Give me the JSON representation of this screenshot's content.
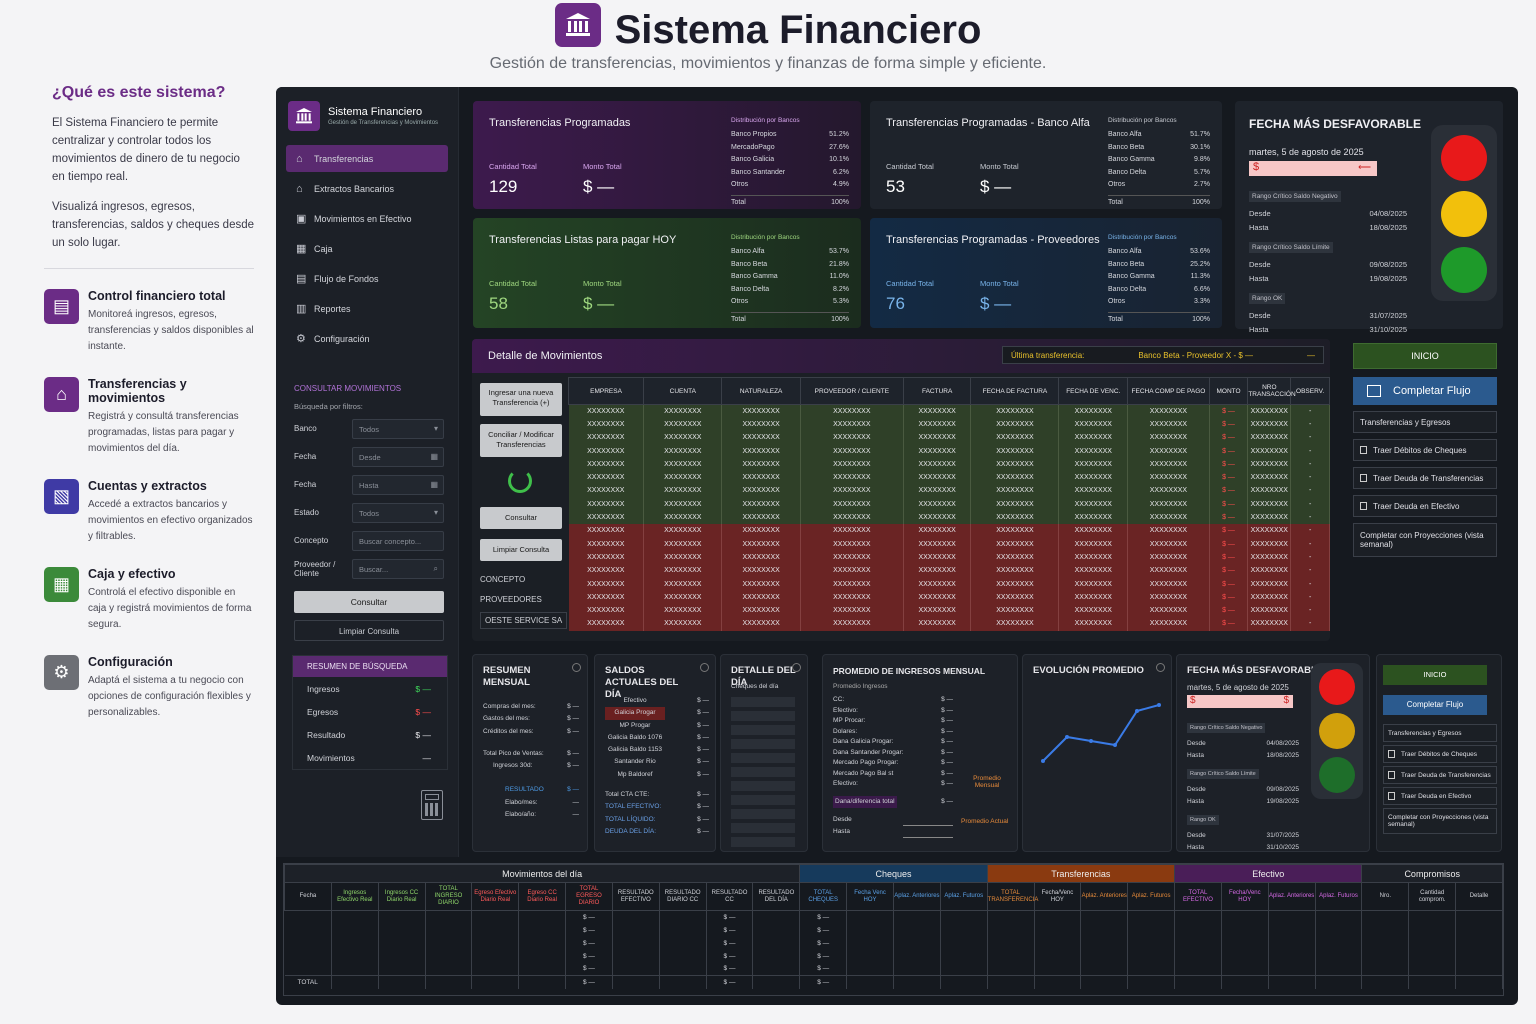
{
  "header": {
    "title": "Sistema Financiero",
    "subtitle": "Gestión de transferencias, movimientos y finanzas de forma simple y eficiente."
  },
  "intro": {
    "title": "¿Qué es este sistema?",
    "p1": "El Sistema Financiero te permite centralizar y controlar todos los movimientos de dinero de tu negocio en tiempo real.",
    "p2": "Visualizá ingresos, egresos, transferencias, saldos y cheques desde un solo lugar."
  },
  "features": [
    {
      "title": "Control financiero total",
      "text": "Monitoreá ingresos, egresos, transferencias y saldos disponibles al instante.",
      "color": "#6b2c86",
      "icon": "chart-icon"
    },
    {
      "title": "Transferencias y movimientos",
      "text": "Registrá y consultá transferencias programadas, listas para pagar y movimientos del día.",
      "color": "#6b2c86",
      "icon": "bank-icon"
    },
    {
      "title": "Cuentas y extractos",
      "text": "Accedé a extractos bancarios y movimientos en efectivo organizados y filtrables.",
      "color": "#3f3aa5",
      "icon": "document-icon"
    },
    {
      "title": "Caja y efectivo",
      "text": "Controlá el efectivo disponible en caja y registrá movimientos de forma segura.",
      "color": "#3b8a3a",
      "icon": "register-icon"
    },
    {
      "title": "Configuración",
      "text": "Adaptá el sistema a tu negocio con opciones de configuración flexibles y personalizables.",
      "color": "#6d6f75",
      "icon": "gear-icon"
    }
  ],
  "sidebar": {
    "title": "Sistema Financiero",
    "subtitle": "Gestión de Transferencias y Movimientos",
    "items": [
      {
        "label": "Transferencias",
        "icon": "bank-icon"
      },
      {
        "label": "Extractos Bancarios",
        "icon": "bank-icon"
      },
      {
        "label": "Movimientos en Efectivo",
        "icon": "cash-icon"
      },
      {
        "label": "Caja",
        "icon": "register-icon"
      },
      {
        "label": "Flujo de Fondos",
        "icon": "document-icon"
      },
      {
        "label": "Reportes",
        "icon": "report-icon"
      },
      {
        "label": "Configuración",
        "icon": "gear-icon"
      }
    ],
    "consult_title": "CONSULTAR MOVIMIENTOS",
    "filters_label": "Búsqueda por filtros:",
    "filters": [
      {
        "label": "Banco",
        "value": "Todos"
      },
      {
        "label": "Fecha",
        "value": "Desde"
      },
      {
        "label": "Fecha",
        "value": "Hasta"
      },
      {
        "label": "Estado",
        "value": "Todos"
      },
      {
        "label": "Concepto",
        "value": "Buscar concepto..."
      },
      {
        "label": "Proveedor / Cliente",
        "value": "Buscar..."
      }
    ],
    "consult_btn": "Consultar",
    "clear_btn": "Limpiar Consulta",
    "summary": {
      "title": "RESUMEN DE BÚSQUEDA",
      "rows": [
        {
          "label": "Ingresos",
          "value": "$ —"
        },
        {
          "label": "Egresos",
          "value": "$ —"
        },
        {
          "label": "Resultado",
          "value": "$ —"
        },
        {
          "label": "Movimientos",
          "value": "—"
        }
      ]
    }
  },
  "cards": {
    "c1": {
      "title": "Transferencias Programadas",
      "qty_label": "Cantidad Total",
      "qty": "129",
      "amt_label": "Monto Total",
      "amt": "$ —",
      "dist_title": "Distribución por Bancos",
      "dist": [
        [
          "Banco Propios",
          "51.2%"
        ],
        [
          "MercadoPago",
          "27.6%"
        ],
        [
          "Banco Galicia",
          "10.1%"
        ],
        [
          "Banco Santander",
          "6.2%"
        ],
        [
          "Otros",
          "4.9%"
        ]
      ],
      "total": [
        "Total",
        "100%"
      ]
    },
    "c2": {
      "title": "Transferencias Programadas - Banco Alfa",
      "qty_label": "Cantidad Total",
      "qty": "53",
      "amt_label": "Monto Total",
      "amt": "$ —",
      "dist_title": "Distribución por Bancos",
      "dist": [
        [
          "Banco Alfa",
          "51.7%"
        ],
        [
          "Banco Beta",
          "30.1%"
        ],
        [
          "Banco Gamma",
          "9.8%"
        ],
        [
          "Banco Delta",
          "5.7%"
        ],
        [
          "Otros",
          "2.7%"
        ]
      ],
      "total": [
        "Total",
        "100%"
      ]
    },
    "c3": {
      "title": "Transferencias Listas para pagar HOY",
      "qty_label": "Cantidad Total",
      "qty": "58",
      "amt_label": "Monto Total",
      "amt": "$ —",
      "dist_title": "Distribución por Bancos",
      "dist": [
        [
          "Banco Alfa",
          "53.7%"
        ],
        [
          "Banco Beta",
          "21.8%"
        ],
        [
          "Banco Gamma",
          "11.0%"
        ],
        [
          "Banco Delta",
          "8.2%"
        ],
        [
          "Otros",
          "5.3%"
        ]
      ],
      "total": [
        "Total",
        "100%"
      ]
    },
    "c4": {
      "title": "Transferencias Programadas - Proveedores",
      "qty_label": "Cantidad Total",
      "qty": "76",
      "amt_label": "Monto Total",
      "amt": "$ —",
      "dist_title": "Distribución por Bancos",
      "dist": [
        [
          "Banco Alfa",
          "53.6%"
        ],
        [
          "Banco Beta",
          "25.2%"
        ],
        [
          "Banco Gamma",
          "11.3%"
        ],
        [
          "Banco Delta",
          "6.6%"
        ],
        [
          "Otros",
          "3.3%"
        ]
      ],
      "total": [
        "Total",
        "100%"
      ]
    }
  },
  "fecha": {
    "title": "FECHA MÁS DESFAVORABLE",
    "date": "martes, 5 de agosto de 2025",
    "bar": "$",
    "ranges": [
      {
        "title": "Rango Crítico Saldo Negativo",
        "desde": "04/08/2025",
        "hasta": "18/08/2025"
      },
      {
        "title": "Rango Crítico Saldo Límite",
        "desde": "09/08/2025",
        "hasta": "19/08/2025"
      },
      {
        "title": "Rango OK",
        "desde": "31/07/2025",
        "hasta": "31/10/2025"
      }
    ],
    "desde_label": "Desde",
    "hasta_label": "Hasta"
  },
  "detalle": {
    "title": "Detalle de Movimientos",
    "ultima_label": "Última transferencia:",
    "ultima_value": "Banco Beta - Proveedor X - $ —",
    "ultima_dash": "—",
    "btn_new": "Ingresar una nueva Transferencia (+)",
    "btn_mod": "Conciliar / Modificar Transferencias",
    "btn_consult": "Consultar",
    "btn_clear": "Limpiar Consulta",
    "lbl_concepto": "CONCEPTO",
    "lbl_prov": "PROVEEDORES",
    "lbl_oeste": "OESTE SERVICE SA",
    "columns": [
      "EMPRESA",
      "CUENTA",
      "NATURALEZA",
      "PROVEEDOR / CLIENTE",
      "FACTURA",
      "FECHA DE FACTURA",
      "FECHA DE VENC.",
      "FECHA COMP DE PAGO",
      "MONTO",
      "NRO TRANSACCIÓN",
      "OBSERV."
    ],
    "cell": "XXXXXXXX",
    "monto": "$ —",
    "obs": "-"
  },
  "actions": {
    "inicio": "INICIO",
    "completar": "Completar Flujo",
    "items": [
      "Transferencias y Egresos",
      "Traer Débitos de Cheques",
      "Traer Deuda de Transferencias",
      "Traer Deuda en Efectivo",
      "Completar con Proyecciones (vista semanal)"
    ]
  },
  "resumen": {
    "title": "RESUMEN MENSUAL",
    "rows": [
      [
        "Compras del mes:",
        "$ —"
      ],
      [
        "Gastos del mes:",
        "$ —"
      ],
      [
        "Créditos del mes:",
        "$ —"
      ]
    ],
    "pico": [
      "Total Pico de Ventas:",
      "$ —"
    ],
    "ing30": [
      "Ingresos 30d:",
      "$ —"
    ],
    "resultado": [
      "RESULTADO",
      "$ —"
    ],
    "elab_mes": [
      "Elabo/mes:",
      "—"
    ],
    "elab_ano": [
      "Elabo/año:",
      "—"
    ]
  },
  "saldos": {
    "title": "SALDOS ACTUALES DEL DÍA",
    "rows": [
      "Efectivo",
      "Galicia Progar",
      "MP Progar",
      "Galicia Baldo 1076",
      "Galicia Baldo 1153",
      "Santander Rio",
      "Mp Baldoref"
    ],
    "val": "$ —",
    "tot": [
      "Total CTA CTE:",
      "TOTAL EFECTIVO:",
      "TOTAL LÍQUIDO:",
      "DEUDA DEL DÍA:"
    ]
  },
  "detdia": {
    "title": "DETALLE DEL DÍA",
    "sub": "Cheques del día"
  },
  "promedio": {
    "title": "PROMEDIO DE INGRESOS MENSUAL",
    "sub": "Promedio Ingresos",
    "rows": [
      "CC:",
      "Efectivo:",
      "MP Procar:",
      "Dolares:",
      "Dana Galicia Progar:",
      "Dana Santander Progar:",
      "Mercado Pago Progar:",
      "Mercado Pago Bal st",
      "Efectivo:"
    ],
    "val": "$ —",
    "dif": "Dana/diferencia total",
    "desde": "Desde",
    "hasta": "Hasta",
    "pm": "Promedio Mensual",
    "pa": "Promedio Actual"
  },
  "evol": {
    "title": "EVOLUCIÓN PROMEDIO"
  },
  "fecha2": {
    "title": "FECHA MÁS DESFAVORABLE",
    "date": "martes, 5 de agosto de 2025",
    "bar": "$"
  },
  "footer": {
    "groups": [
      {
        "label": "Movimientos del día",
        "color": "#1d2128"
      },
      {
        "label": "Cheques",
        "color": "#163a5c"
      },
      {
        "label": "Transferencias",
        "color": "#8a3a10"
      },
      {
        "label": "Efectivo",
        "color": "#4a1e58"
      },
      {
        "label": "Compromisos",
        "color": "#1d2128"
      }
    ],
    "cols": [
      [
        "Fecha",
        "#d0d2d8"
      ],
      [
        "Ingresos Efectivo Real",
        "#8fd66a"
      ],
      [
        "Ingresos CC Diario Real",
        "#8fd66a"
      ],
      [
        "TOTAL INGRESO DIARIO",
        "#8fd66a"
      ],
      [
        "Egreso Efectivo Diario Real",
        "#ff5a5a"
      ],
      [
        "Egreso CC Diario Real",
        "#ff5a5a"
      ],
      [
        "TOTAL EGRESO DIARIO",
        "#ff5a5a"
      ],
      [
        "RESULTADO EFECTIVO",
        "#d0d2d8"
      ],
      [
        "RESULTADO DIARIO CC",
        "#d0d2d8"
      ],
      [
        "RESULTADO CC",
        "#d0d2d8"
      ],
      [
        "RESULTADO DEL DÍA",
        "#d0d2d8"
      ],
      [
        "TOTAL CHEQUES",
        "#5aa0e6"
      ],
      [
        "Fecha Venc HOY",
        "#5aa0e6"
      ],
      [
        "Aplaz. Anteriores",
        "#5aa0e6"
      ],
      [
        "Aplaz. Futuros",
        "#5aa0e6"
      ],
      [
        "TOTAL TRANSFERENCIA",
        "#e68a3a"
      ],
      [
        "Fecha/Venc HOY",
        "#d0d2d8"
      ],
      [
        "Aplaz. Anteriores",
        "#e68a3a"
      ],
      [
        "Aplaz. Futuros",
        "#e68a3a"
      ],
      [
        "TOTAL EFECTIVO",
        "#d66ae6"
      ],
      [
        "Fecha/Venc HOY",
        "#d66ae6"
      ],
      [
        "Aplaz. Anteriores",
        "#d66ae6"
      ],
      [
        "Aplaz. Futuros",
        "#d66ae6"
      ],
      [
        "Nro.",
        "#d0d2d8"
      ],
      [
        "Cantidad comprom.",
        "#d0d2d8"
      ],
      [
        "Detalle",
        "#d0d2d8"
      ]
    ],
    "total": "TOTAL",
    "val": "$ —"
  }
}
